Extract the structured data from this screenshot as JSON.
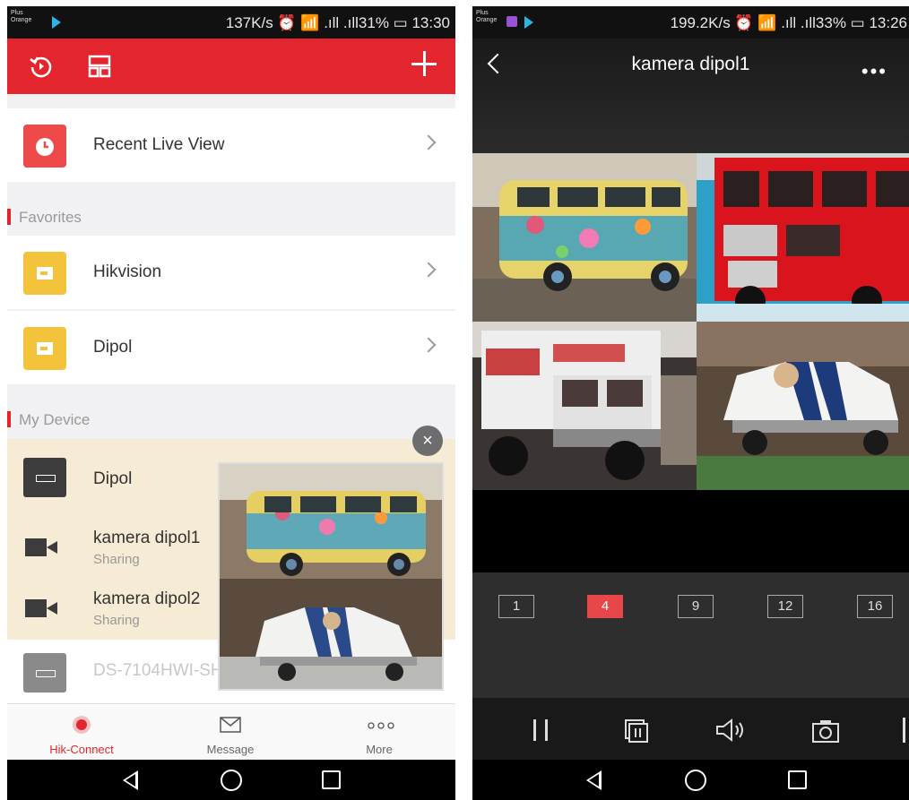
{
  "left": {
    "status": {
      "carrier_line1": "Plus",
      "carrier_line2": "Orange",
      "right": "137K/s ⏰ 📶 .ıll .ıll31% ▭ 13:30"
    },
    "header": {
      "add_icon": "plus-icon",
      "history_icon": "playback-icon",
      "layout_icon": "layout-icon"
    },
    "recent": {
      "label": "Recent Live View"
    },
    "favorites": {
      "title": "Favorites",
      "items": [
        {
          "label": "Hikvision"
        },
        {
          "label": "Dipol"
        }
      ]
    },
    "my_device": {
      "title": "My Device",
      "items": [
        {
          "label": "Dipol",
          "sub": ""
        },
        {
          "label": "kamera dipol1",
          "sub": "Sharing"
        },
        {
          "label": "kamera dipol2",
          "sub": "Sharing"
        },
        {
          "label": "DS-7104HWI-SH",
          "sub": ""
        }
      ]
    },
    "popup": {
      "close": "×"
    },
    "tabs": [
      {
        "label": "Hik-Connect",
        "icon": "hik-connect-icon",
        "active": true
      },
      {
        "label": "Message",
        "icon": "envelope-icon",
        "active": false
      },
      {
        "label": "More",
        "icon": "more-dots-icon",
        "active": false
      }
    ]
  },
  "right": {
    "status": {
      "carrier_line1": "Plus",
      "carrier_line2": "Orange",
      "right": "199.2K/s ⏰ 📶 .ıll .ıll33% ▭ 13:26"
    },
    "title": "kamera dipol1",
    "menu": "•••",
    "split_options": [
      "1",
      "4",
      "9",
      "12",
      "16"
    ],
    "split_active": "4",
    "controls": [
      "pause-icon",
      "record-icon",
      "sound-icon",
      "snapshot-icon"
    ]
  },
  "colors": {
    "accent": "#e3262e",
    "highlight_row": "#f6ebd5"
  }
}
